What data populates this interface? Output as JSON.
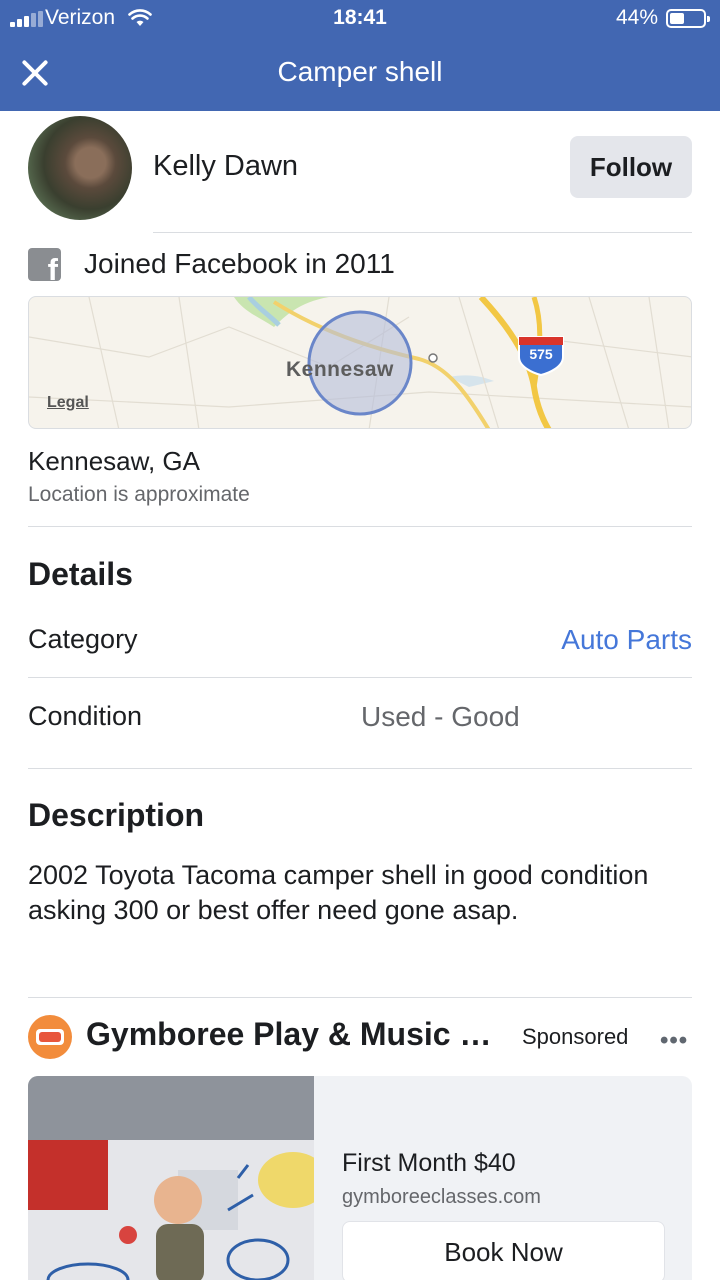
{
  "status_bar": {
    "carrier": "Verizon",
    "time": "18:41",
    "battery": "44%",
    "battery_level": 0.44
  },
  "nav": {
    "title": "Camper shell",
    "close_icon": "close-icon"
  },
  "seller": {
    "name": "Kelly Dawn",
    "follow_label": "Follow",
    "joined": "Joined Facebook in 2011"
  },
  "map": {
    "label": "Kennesaw",
    "legal": "Legal",
    "route_shield": "575"
  },
  "location": {
    "city": "Kennesaw, GA",
    "note": "Location is approximate"
  },
  "details": {
    "heading": "Details",
    "category_label": "Category",
    "category_value": "Auto Parts",
    "condition_label": "Condition",
    "condition_value": "Used - Good"
  },
  "description": {
    "heading": "Description",
    "text": "2002 Toyota Tacoma camper shell in good condition  asking 300 or best offer need gone asap."
  },
  "ad": {
    "advertiser": "Gymboree Play & Music Classes",
    "sponsored": "Sponsored",
    "more": "•••",
    "title": "First Month $40",
    "domain": "gymboreeclasses.com",
    "cta": "Book Now"
  },
  "colors": {
    "nav_blue": "#4267b2",
    "link_blue": "#4577d9"
  }
}
